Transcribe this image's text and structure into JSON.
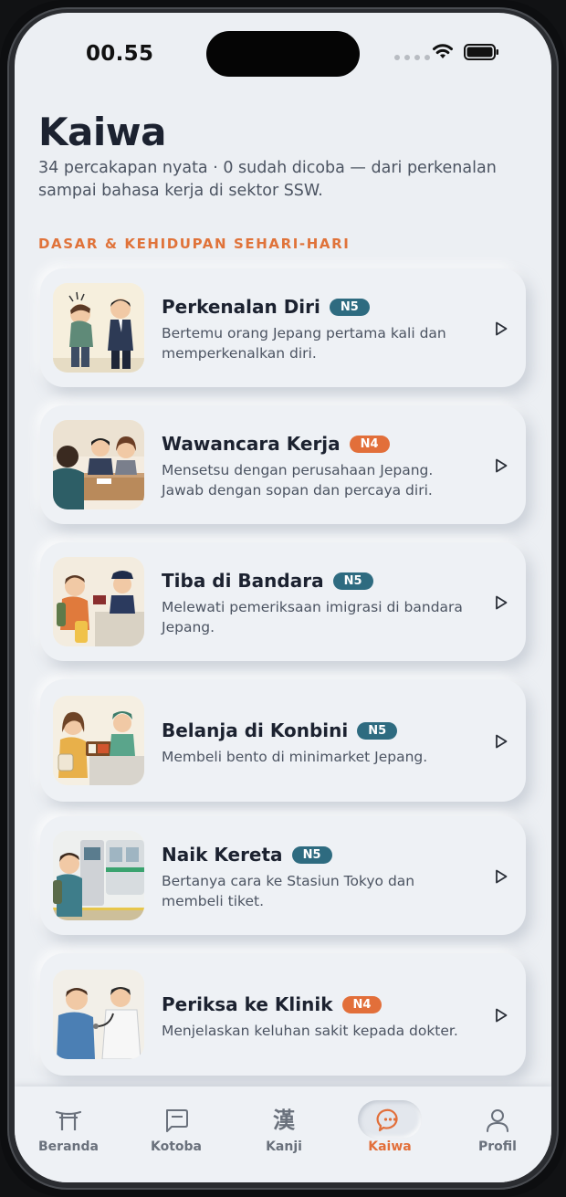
{
  "status": {
    "time": "00.55"
  },
  "header": {
    "title": "Kaiwa",
    "subtitle": "34 percakapan nyata · 0 sudah dicoba — dari perkenalan sampai bahasa kerja di sektor SSW."
  },
  "section": {
    "title": "DASAR & KEHIDUPAN SEHARI-HARI"
  },
  "lessons": [
    {
      "title": "Perkenalan Diri",
      "level": "N5",
      "desc": "Bertemu orang Jepang pertama kali dan memperkenalkan diri."
    },
    {
      "title": "Wawancara Kerja",
      "level": "N4",
      "desc": "Mensetsu dengan perusahaan Jepang. Jawab dengan sopan dan percaya diri."
    },
    {
      "title": "Tiba di Bandara",
      "level": "N5",
      "desc": "Melewati pemeriksaan imigrasi di bandara Jepang."
    },
    {
      "title": "Belanja di Konbini",
      "level": "N5",
      "desc": "Membeli bento di minimarket Jepang."
    },
    {
      "title": "Naik Kereta",
      "level": "N5",
      "desc": "Bertanya cara ke Stasiun Tokyo dan membeli tiket."
    },
    {
      "title": "Periksa ke Klinik",
      "level": "N4",
      "desc": "Menjelaskan keluhan sakit kepada dokter."
    }
  ],
  "tabs": [
    {
      "label": "Beranda",
      "icon": "torii-icon"
    },
    {
      "label": "Kotoba",
      "icon": "message-square-icon"
    },
    {
      "label": "Kanji",
      "icon": "kanji-icon",
      "glyph": "漢"
    },
    {
      "label": "Kaiwa",
      "icon": "chat-bubble-icon",
      "active": true
    },
    {
      "label": "Profil",
      "icon": "user-icon"
    }
  ],
  "colors": {
    "accent": "#e26f3a",
    "n5_badge": "#2e6b80",
    "n4_badge": "#e26f3a",
    "background": "#eceff3"
  }
}
